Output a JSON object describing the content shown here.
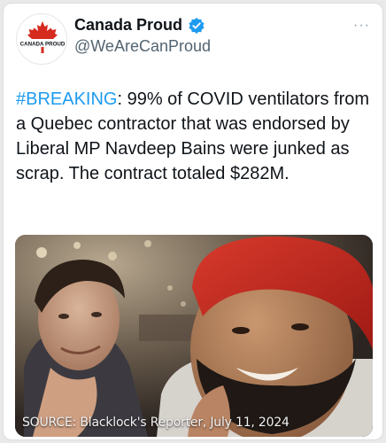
{
  "account": {
    "display_name": "Canada Proud",
    "handle": "@WeAreCanProud",
    "avatar_text": "CANADA PROUD",
    "verified_icon": "verified-badge-icon"
  },
  "more_icon": "more-options-icon",
  "tweet": {
    "hashtag": "#BREAKING",
    "body": ": 99% of COVID ventilators from a Quebec contractor that was endorsed by Liberal MP Navdeep Bains were junked as scrap. The contract totaled $282M."
  },
  "media": {
    "caption": "SOURCE: Blacklock's Reporter, July 11, 2024"
  },
  "colors": {
    "accent": "#1d9bf0",
    "text": "#0f1419",
    "secondary": "#536471",
    "maple_red": "#d52b1e"
  }
}
